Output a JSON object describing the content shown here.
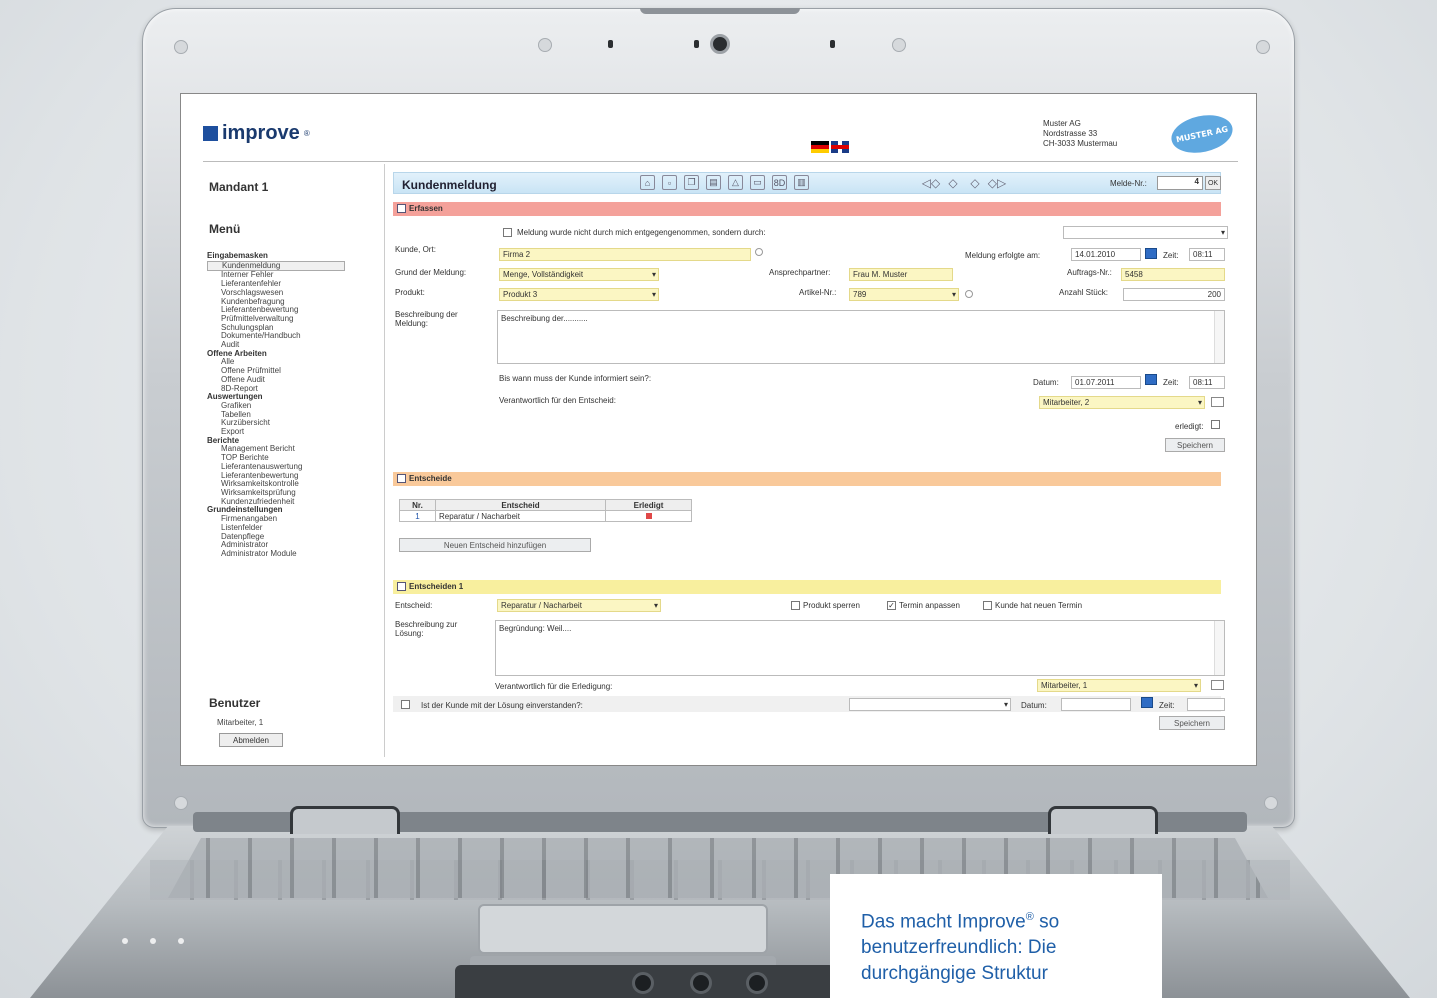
{
  "brand": {
    "name": "improve",
    "reg": "®"
  },
  "company": {
    "line1": "Muster AG",
    "line2": "Nordstrasse 33",
    "line3": "CH-3033 Mustermau",
    "logo_text": "MUSTER AG"
  },
  "sidebar": {
    "mandant": "Mandant 1",
    "menu_title": "Menü",
    "groups": [
      {
        "title": "Eingabemasken",
        "items": [
          "Kundenmeldung",
          "Interner Fehler",
          "Lieferantenfehler",
          "Vorschlagswesen",
          "Kundenbefragung",
          "Lieferantenbewertung",
          "Prüfmittelverwaltung",
          "Schulungsplan",
          "Dokumente/Handbuch",
          "Audit"
        ]
      },
      {
        "title": "Offene Arbeiten",
        "items": [
          "Alle",
          "Offene Prüfmittel",
          "Offene Audit",
          "8D-Report"
        ]
      },
      {
        "title": "Auswertungen",
        "items": [
          "Grafiken",
          "Tabellen",
          "Kurzübersicht",
          "Export"
        ]
      },
      {
        "title": "Berichte",
        "items": [
          "Management Bericht",
          "TOP Berichte",
          "Lieferantenauswertung",
          "Lieferantenbewertung",
          "Wirksamkeitskontrolle",
          "Wirksamkeitsprüfung",
          "Kundenzufriedenheit"
        ]
      },
      {
        "title": "Grundeinstellungen",
        "items": [
          "Firmenangaben",
          "Listenfelder",
          "Datenpflege",
          "Administrator",
          "Administrator Module"
        ]
      }
    ],
    "active_item": "Kundenmeldung",
    "user_title": "Benutzer",
    "user_name": "Mitarbeiter, 1",
    "logout": "Abmelden"
  },
  "main": {
    "title": "Kundenmeldung",
    "toolbar_icons": [
      "home-icon",
      "new-doc-icon",
      "copy-icon",
      "print-icon",
      "pdf-icon",
      "folder-icon",
      "8d-icon",
      "trash-icon"
    ],
    "toolbar_8d": "8D",
    "nav_icons": [
      "first-icon",
      "prev-icon",
      "next-icon",
      "last-icon"
    ],
    "meldenr_label": "Melde-Nr.:",
    "meldenr_value": "4",
    "ok": "OK",
    "erfassen": {
      "title": "Erfassen",
      "not_received_label": "Meldung wurde nicht durch mich entgegengenommen, sondern durch:",
      "kunde_label": "Kunde, Ort:",
      "kunde_value": "Firma 2",
      "erfolgt_label": "Meldung erfolgte am:",
      "erfolgt_date": "14.01.2010",
      "zeit_label": "Zeit:",
      "zeit_value": "08:11",
      "grund_label": "Grund der Meldung:",
      "grund_value": "Menge, Vollständigkeit",
      "ansprech_label": "Ansprechpartner:",
      "ansprech_value": "Frau M. Muster",
      "auftrag_label": "Auftrags-Nr.:",
      "auftrag_value": "5458",
      "produkt_label": "Produkt:",
      "produkt_value": "Produkt 3",
      "artikel_label": "Artikel-Nr.:",
      "artikel_value": "789",
      "stueck_label": "Anzahl Stück:",
      "stueck_value": "200",
      "beschr_label": "Beschreibung der Meldung:",
      "beschr_value": "Beschreibung der...........",
      "bis_wann_label": "Bis wann muss der Kunde informiert sein?:",
      "datum_label": "Datum:",
      "datum_value": "01.07.2011",
      "zeit2_value": "08:11",
      "verantw_label": "Verantwortlich für den Entscheid:",
      "verantw_value": "Mitarbeiter, 2",
      "erledigt_label": "erledigt:",
      "save": "Speichern"
    },
    "entscheide": {
      "title": "Entscheide",
      "headers": [
        "Nr.",
        "Entscheid",
        "Erledigt"
      ],
      "rows": [
        {
          "nr": "1",
          "entscheid": "Reparatur / Nacharbeit"
        }
      ],
      "add_button": "Neuen Entscheid hinzufügen"
    },
    "entscheiden1": {
      "title": "Entscheiden 1",
      "entscheid_label": "Entscheid:",
      "entscheid_value": "Reparatur / Nacharbeit",
      "cb1": "Produkt sperren",
      "cb2": "Termin anpassen",
      "cb3": "Kunde hat neuen Termin",
      "beschr_label": "Beschreibung zur Lösung:",
      "beschr_value": "Begründung: Weil....",
      "verantw_label": "Verantwortlich für die Erledigung:",
      "verantw_value": "Mitarbeiter, 1",
      "einverstanden_label": "Ist der Kunde mit der Lösung einverstanden?:",
      "datum_label": "Datum:",
      "zeit_label": "Zeit:",
      "save": "Speichern"
    }
  },
  "caption": {
    "line1a": "Das macht Improve",
    "line1b": "so",
    "reg": "®",
    "line2": "benutzerfreundlich: Die",
    "line3": "durchgängige Struktur"
  },
  "colors": {
    "erfassen": "#f4a19a",
    "entscheide": "#f9c99a",
    "entscheiden1": "#f8ef9e",
    "brand": "#1e4f9e",
    "caption": "#1f5fa8"
  }
}
